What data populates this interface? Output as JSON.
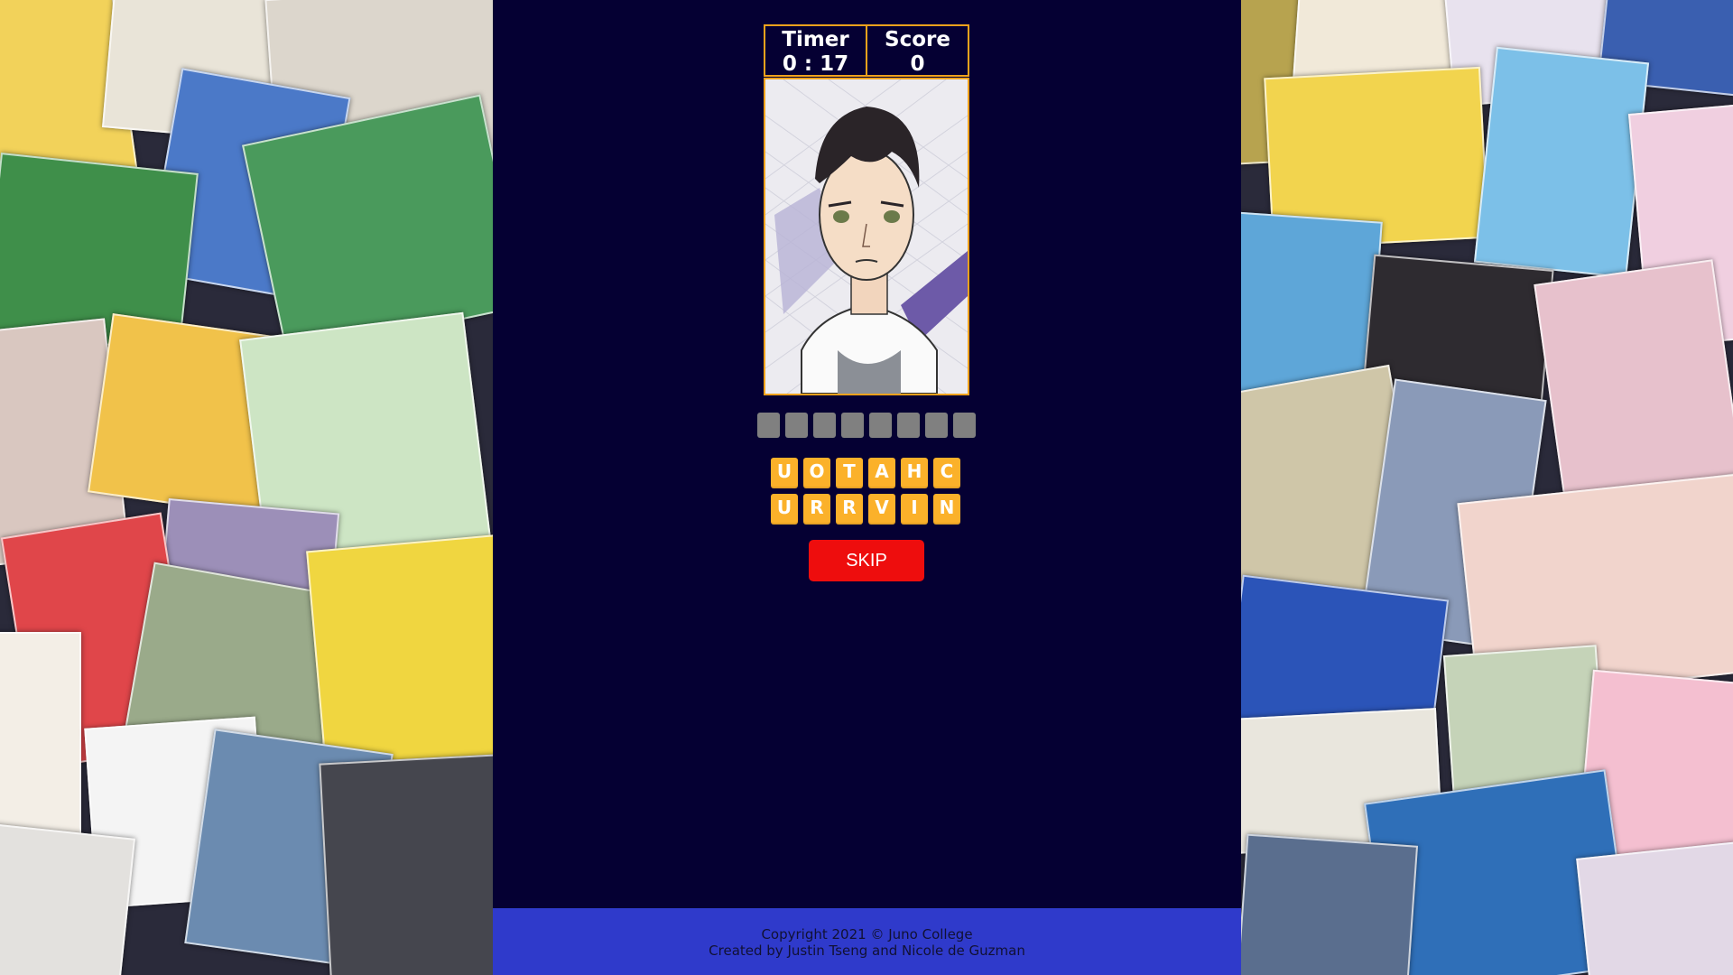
{
  "scoreboard": {
    "timer_label": "Timer",
    "timer_value": "0 : 17",
    "score_label": "Score",
    "score_value": "0"
  },
  "answer_blanks": 8,
  "letter_rows": [
    [
      "U",
      "O",
      "T",
      "A",
      "H",
      "C"
    ],
    [
      "U",
      "R",
      "R",
      "V",
      "I",
      "N"
    ]
  ],
  "skip_label": "SKIP",
  "footer": {
    "copyright": "Copyright 2021 © Juno College",
    "credits": "Created by Justin Tseng and Nicole de Guzman"
  },
  "colors": {
    "background": "#050033",
    "accent_border": "#f0a21c",
    "letter_tile": "#fbb12a",
    "skip_button": "#ee0d0d",
    "footer": "#2f3acb",
    "blank_tile": "#808080"
  }
}
